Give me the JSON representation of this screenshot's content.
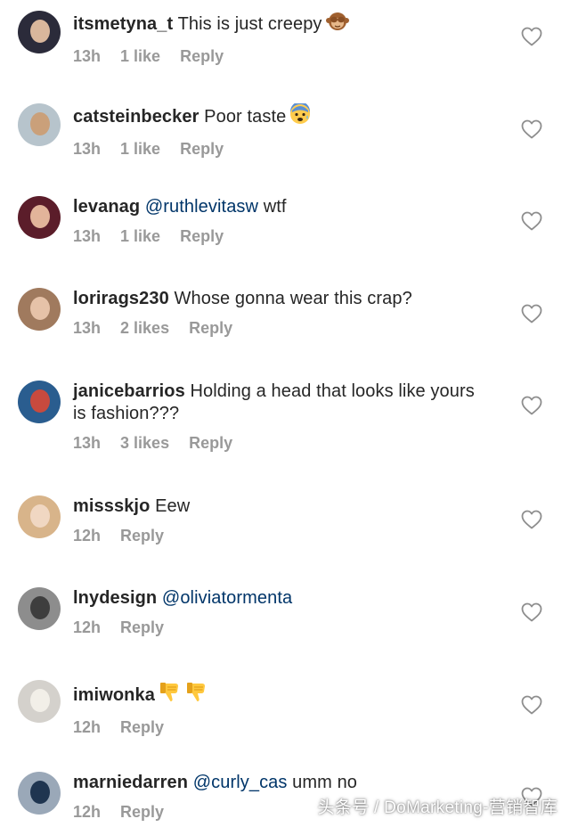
{
  "comments": [
    {
      "username": "itsmetyna_t",
      "text": "This is just creepy",
      "time": "13h",
      "likes": "1 like",
      "reply": "Reply",
      "emoji": [
        "see-no-evil-monkey"
      ],
      "avatar_colors": [
        "#2b2b3a",
        "#d9b79c"
      ]
    },
    {
      "username": "catsteinbecker",
      "text": "Poor taste",
      "time": "13h",
      "likes": "1 like",
      "reply": "Reply",
      "emoji": [
        "anxious-face"
      ],
      "avatar_colors": [
        "#b7c4cc",
        "#caa07a"
      ]
    },
    {
      "username": "levanag",
      "mention": "@ruthlevitasw",
      "text": "wtf",
      "time": "13h",
      "likes": "1 like",
      "reply": "Reply",
      "emoji": [],
      "avatar_colors": [
        "#5b1d2a",
        "#e2b49a"
      ]
    },
    {
      "username": "lorirags230",
      "text": "Whose gonna wear this crap?",
      "time": "13h",
      "likes": "2 likes",
      "reply": "Reply",
      "emoji": [],
      "avatar_colors": [
        "#a07a5e",
        "#e6c2a8"
      ]
    },
    {
      "username": "janicebarrios",
      "text": "Holding a head that looks like yours is fashion???",
      "time": "13h",
      "likes": "3 likes",
      "reply": "Reply",
      "emoji": [],
      "avatar_colors": [
        "#2a5d8f",
        "#c84a3e"
      ]
    },
    {
      "username": "missskjo",
      "text": "Eew",
      "time": "12h",
      "likes": "",
      "reply": "Reply",
      "emoji": [],
      "avatar_colors": [
        "#d8b48a",
        "#f0d7c2"
      ]
    },
    {
      "username": "lnydesign",
      "mention": "@oliviatormenta",
      "text": "",
      "time": "12h",
      "likes": "",
      "reply": "Reply",
      "emoji": [],
      "avatar_colors": [
        "#8d8d8d",
        "#3e3e3e"
      ]
    },
    {
      "username": "imiwonka",
      "text": "",
      "time": "12h",
      "likes": "",
      "reply": "Reply",
      "emoji": [
        "thumbs-down",
        "thumbs-down"
      ],
      "avatar_colors": [
        "#d4d1cc",
        "#f2efe8"
      ]
    },
    {
      "username": "marniedarren",
      "mention": "@curly_cas",
      "text": "umm no",
      "time": "12h",
      "likes": "",
      "reply": "Reply",
      "emoji": [],
      "avatar_colors": [
        "#9aa8b8",
        "#1f3550"
      ]
    }
  ],
  "watermark": "头条号 / DoMarketing-营销智库",
  "colors": {
    "text": "#262626",
    "meta": "#999999",
    "mention": "#003569",
    "heart_stroke": "#8e8e8e"
  }
}
